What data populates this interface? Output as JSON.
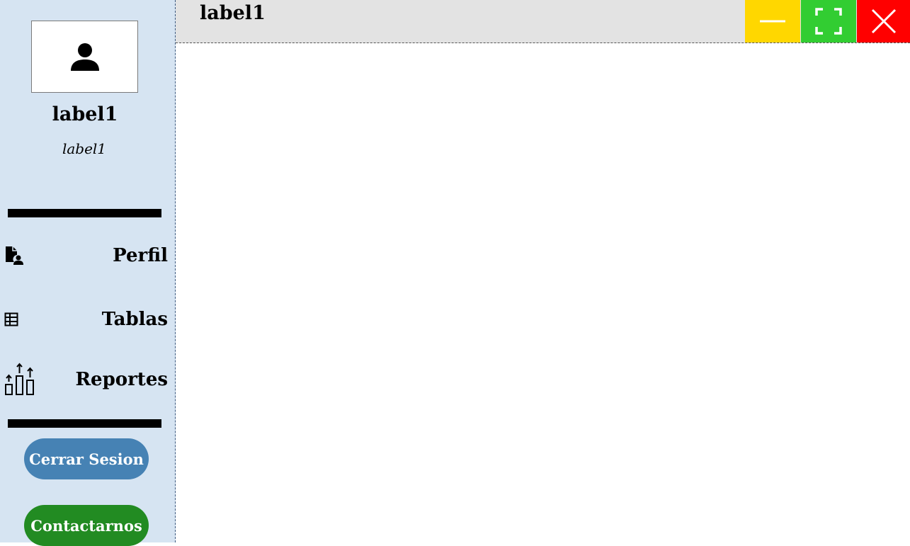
{
  "header": {
    "title": "label1",
    "window_controls": {
      "minimize_icon": "minimize-icon",
      "maximize_icon": "maximize-icon",
      "close_icon": "close-icon",
      "minimize_color": "#FFD700",
      "maximize_color": "#32CD32",
      "close_color": "#FF0000"
    }
  },
  "sidebar": {
    "avatar_icon": "user-icon",
    "user_name": "label1",
    "user_role": "label1",
    "items": [
      {
        "label": "Perfil",
        "icon": "profile-document-icon"
      },
      {
        "label": "Tablas",
        "icon": "table-icon"
      },
      {
        "label": "Reportes",
        "icon": "reports-chart-icon"
      }
    ],
    "logout_label": "Cerrar Sesion",
    "contact_label": "Contactarnos"
  },
  "colors": {
    "sidebar_bg": "#D6E4F2",
    "topbar_bg": "#E3E3E3",
    "logout_button": "#4682B4",
    "contact_button": "#228B22"
  }
}
